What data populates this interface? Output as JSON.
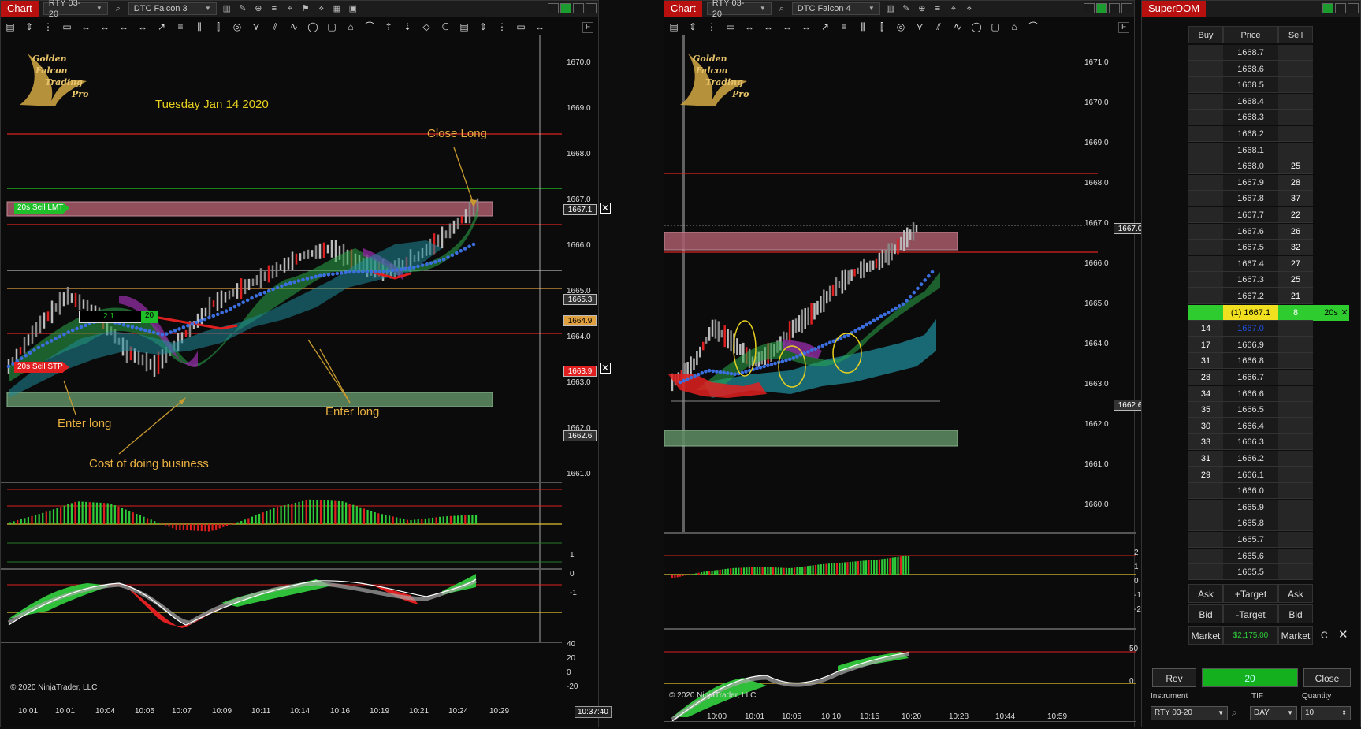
{
  "chart1": {
    "tab": "Chart",
    "instrument": "RTY 03-20",
    "template": "DTC  Falcon  3",
    "logo": [
      "Golden",
      "Falcon",
      "Trading",
      "Pro"
    ],
    "date": "Tuesday Jan 14 2020",
    "annotations": {
      "close_long": "Close Long",
      "enter_long_1": "Enter long",
      "enter_long_2": "Enter long",
      "cost": "Cost of doing business"
    },
    "order_labels": {
      "sell_lmt": "20s  Sell LMT",
      "sell_stp": "20s  Sell STP",
      "qty_box": "2.1",
      "qty_box2": "20"
    },
    "price_axis": [
      "1670.0",
      "1669.0",
      "1668.0",
      "1667.0",
      "1666.0",
      "1665.0",
      "1664.0",
      "1663.0",
      "1662.0",
      "1661.0"
    ],
    "price_tags": [
      "1667.1",
      "1665.3",
      "1664.9",
      "1663.9",
      "1662.6"
    ],
    "osc1_axis": [
      "1",
      "0",
      "-1"
    ],
    "osc2_axis": [
      "40",
      "20",
      "0",
      "-20"
    ],
    "time_axis": [
      "10:01",
      "10:01",
      "10:04",
      "10:05",
      "10:07",
      "10:09",
      "10:11",
      "10:14",
      "10:16",
      "10:19",
      "10:21",
      "10:24",
      "10:29"
    ],
    "time_cursor": "10:37:40",
    "copyright": "© 2020 NinjaTrader, LLC"
  },
  "chart2": {
    "tab": "Chart",
    "instrument": "RTY 03-20",
    "template": "DTC  Falcon  4",
    "logo": [
      "Golden",
      "Falcon",
      "Trading",
      "Pro"
    ],
    "price_axis": [
      "1671.0",
      "1670.0",
      "1669.0",
      "1668.0",
      "1667.0",
      "1666.0",
      "1665.0",
      "1664.0",
      "1663.0",
      "1662.0",
      "1661.0",
      "1660.0"
    ],
    "price_tags": [
      "1667.0",
      "1662.6"
    ],
    "osc1_axis": [
      "2",
      "1",
      "0",
      "-1",
      "-2"
    ],
    "osc2_axis": [
      "50",
      "0"
    ],
    "time_axis": [
      "10:00",
      "10:01",
      "10:05",
      "10:10",
      "10:15",
      "10:20",
      "10:28",
      "10:44",
      "10:59"
    ],
    "copyright": "© 2020 NinjaTrader, LLC"
  },
  "superdom": {
    "tab": "SuperDOM",
    "headers": {
      "buy": "Buy",
      "price": "Price",
      "sell": "Sell"
    },
    "rows": [
      {
        "buy": "",
        "price": "1668.7",
        "sell": ""
      },
      {
        "buy": "",
        "price": "1668.6",
        "sell": ""
      },
      {
        "buy": "",
        "price": "1668.5",
        "sell": ""
      },
      {
        "buy": "",
        "price": "1668.4",
        "sell": ""
      },
      {
        "buy": "",
        "price": "1668.3",
        "sell": ""
      },
      {
        "buy": "",
        "price": "1668.2",
        "sell": ""
      },
      {
        "buy": "",
        "price": "1668.1",
        "sell": ""
      },
      {
        "buy": "",
        "price": "1668.0",
        "sell": "25"
      },
      {
        "buy": "",
        "price": "1667.9",
        "sell": "28"
      },
      {
        "buy": "",
        "price": "1667.8",
        "sell": "37"
      },
      {
        "buy": "",
        "price": "1667.7",
        "sell": "22"
      },
      {
        "buy": "",
        "price": "1667.6",
        "sell": "26"
      },
      {
        "buy": "",
        "price": "1667.5",
        "sell": "32"
      },
      {
        "buy": "",
        "price": "1667.4",
        "sell": "27"
      },
      {
        "buy": "",
        "price": "1667.3",
        "sell": "25"
      },
      {
        "buy": "",
        "price": "1667.2",
        "sell": "21"
      },
      {
        "buy": "",
        "price": "(1) 1667.1",
        "sell": "8",
        "extra": "20s",
        "current": true
      },
      {
        "buy": "14",
        "price": "1667.0",
        "sell": "",
        "last": true
      },
      {
        "buy": "17",
        "price": "1666.9",
        "sell": ""
      },
      {
        "buy": "31",
        "price": "1666.8",
        "sell": ""
      },
      {
        "buy": "28",
        "price": "1666.7",
        "sell": ""
      },
      {
        "buy": "34",
        "price": "1666.6",
        "sell": ""
      },
      {
        "buy": "35",
        "price": "1666.5",
        "sell": ""
      },
      {
        "buy": "30",
        "price": "1666.4",
        "sell": ""
      },
      {
        "buy": "33",
        "price": "1666.3",
        "sell": ""
      },
      {
        "buy": "31",
        "price": "1666.2",
        "sell": ""
      },
      {
        "buy": "29",
        "price": "1666.1",
        "sell": ""
      },
      {
        "buy": "",
        "price": "1666.0",
        "sell": ""
      },
      {
        "buy": "",
        "price": "1665.9",
        "sell": ""
      },
      {
        "buy": "",
        "price": "1665.8",
        "sell": ""
      },
      {
        "buy": "",
        "price": "1665.7",
        "sell": ""
      },
      {
        "buy": "",
        "price": "1665.6",
        "sell": ""
      },
      {
        "buy": "",
        "price": "1665.5",
        "sell": ""
      }
    ],
    "buttons": {
      "ask_left": "Ask",
      "plus_target": "+Target",
      "ask_right": "Ask",
      "bid_left": "Bid",
      "minus_target": "-Target",
      "bid_right": "Bid",
      "market_left": "Market",
      "pnl": "$2,175.00",
      "market_right": "Market",
      "c": "C"
    },
    "footer": {
      "rev": "Rev",
      "position": "20",
      "close": "Close",
      "instrument_label": "Instrument",
      "tif_label": "TIF",
      "quantity_label": "Quantity",
      "instrument": "RTY 03-20",
      "tif": "DAY",
      "quantity": "10"
    }
  },
  "colors": {
    "title_red": "#b80f0f",
    "buy_green": "#2fcc3a",
    "sell_red": "#e02020",
    "teal": "#1f8a9a",
    "purple": "#7a2a8a",
    "blue_dots": "#3b6fe0",
    "gold_text": "#e8c020"
  }
}
